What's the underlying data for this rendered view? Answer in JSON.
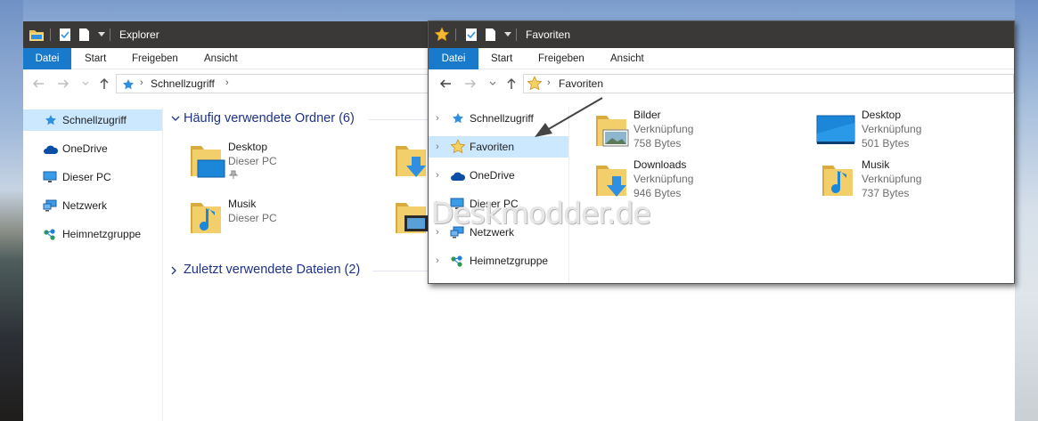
{
  "explorer_window": {
    "title": "Explorer",
    "ribbon_tabs": [
      "Datei",
      "Start",
      "Freigeben",
      "Ansicht"
    ],
    "address_path": "Schnellzugriff",
    "nav": [
      "Schnellzugriff",
      "OneDrive",
      "Dieser PC",
      "Netzwerk",
      "Heimnetzgruppe"
    ],
    "section_frequent": "Häufig verwendete Ordner (6)",
    "section_recent": "Zuletzt verwendete Dateien (2)",
    "folders": [
      {
        "name": "Desktop",
        "location": "Dieser PC"
      },
      {
        "name": "Musik",
        "location": "Dieser PC"
      }
    ]
  },
  "favoriten_window": {
    "title": "Favoriten",
    "ribbon_tabs": [
      "Datei",
      "Start",
      "Freigeben",
      "Ansicht"
    ],
    "address_path": "Favoriten",
    "nav": [
      "Schnellzugriff",
      "Favoriten",
      "OneDrive",
      "Dieser PC",
      "Netzwerk",
      "Heimnetzgruppe"
    ],
    "items": [
      {
        "name": "Bilder",
        "type": "Verknüpfung",
        "size": "758 Bytes"
      },
      {
        "name": "Desktop",
        "type": "Verknüpfung",
        "size": "501 Bytes"
      },
      {
        "name": "Downloads",
        "type": "Verknüpfung",
        "size": "946 Bytes"
      },
      {
        "name": "Musik",
        "type": "Verknüpfung",
        "size": "737 Bytes"
      }
    ]
  },
  "watermark": "Deskmodder.de",
  "colors": {
    "titlebar": "#3a3938",
    "accent": "#1979ca",
    "selection": "#cce8ff",
    "section_title": "#1e3287",
    "folder": "#e8c25f"
  }
}
